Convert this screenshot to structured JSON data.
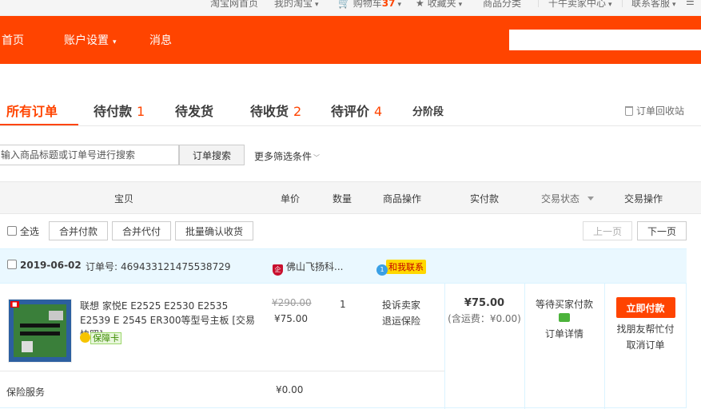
{
  "topbar": {
    "items": [
      "淘宝网首页",
      "我的淘宝",
      "购物车",
      "收藏夹",
      "商品分类",
      "千牛卖家中心",
      "联系客服"
    ],
    "cart_count": "37"
  },
  "header": {
    "nav": [
      "首页",
      "账户设置",
      "消息"
    ]
  },
  "tabs": {
    "all": "所有订单",
    "pending_pay": "待付款",
    "pending_pay_count": "1",
    "pending_ship": "待发货",
    "pending_receive": "待收货",
    "pending_receive_count": "2",
    "pending_review": "待评价",
    "pending_review_count": "4",
    "installment": "分阶段",
    "recycle": "订单回收站"
  },
  "search": {
    "placeholder": "输入商品标题或订单号进行搜索",
    "button": "订单搜索",
    "more_filters": "更多筛选条件"
  },
  "table_header": [
    "宝贝",
    "单价",
    "数量",
    "商品操作",
    "实付款",
    "交易状态",
    "交易操作"
  ],
  "batch": {
    "select_all": "全选",
    "merge_pay": "合并付款",
    "merge_proxy_pay": "合并代付",
    "batch_confirm": "批量确认收货",
    "prev_page": "上一页",
    "next_page": "下一页"
  },
  "order": {
    "date": "2019-06-02",
    "order_no_label": "订单号:",
    "order_no": "469433121475538729",
    "shop": "佛山飞扬科...",
    "contact": "和我联系",
    "item": {
      "title": "联想 家悦E E2525 E2530 E2535 E2539 E 2545 ER300等型号主板 [交易快照]",
      "guarantee": "保障卡",
      "price_original": "¥290.00",
      "price_now": "¥75.00",
      "quantity": "1",
      "ops": [
        "投诉卖家",
        "退运保险"
      ]
    },
    "paid_amount": "¥75.00",
    "shipping": "(含运费：¥0.00)",
    "status_text": "等待买家付款",
    "order_detail": "订单详情",
    "pay_now": "立即付款",
    "ask_friend": "找朋友帮忙付",
    "cancel": "取消订单",
    "insurance_label": "保险服务",
    "insurance_price": "¥0.00"
  },
  "colors": {
    "brand": "#ff4400",
    "order_head_bg": "#eaf8ff"
  }
}
